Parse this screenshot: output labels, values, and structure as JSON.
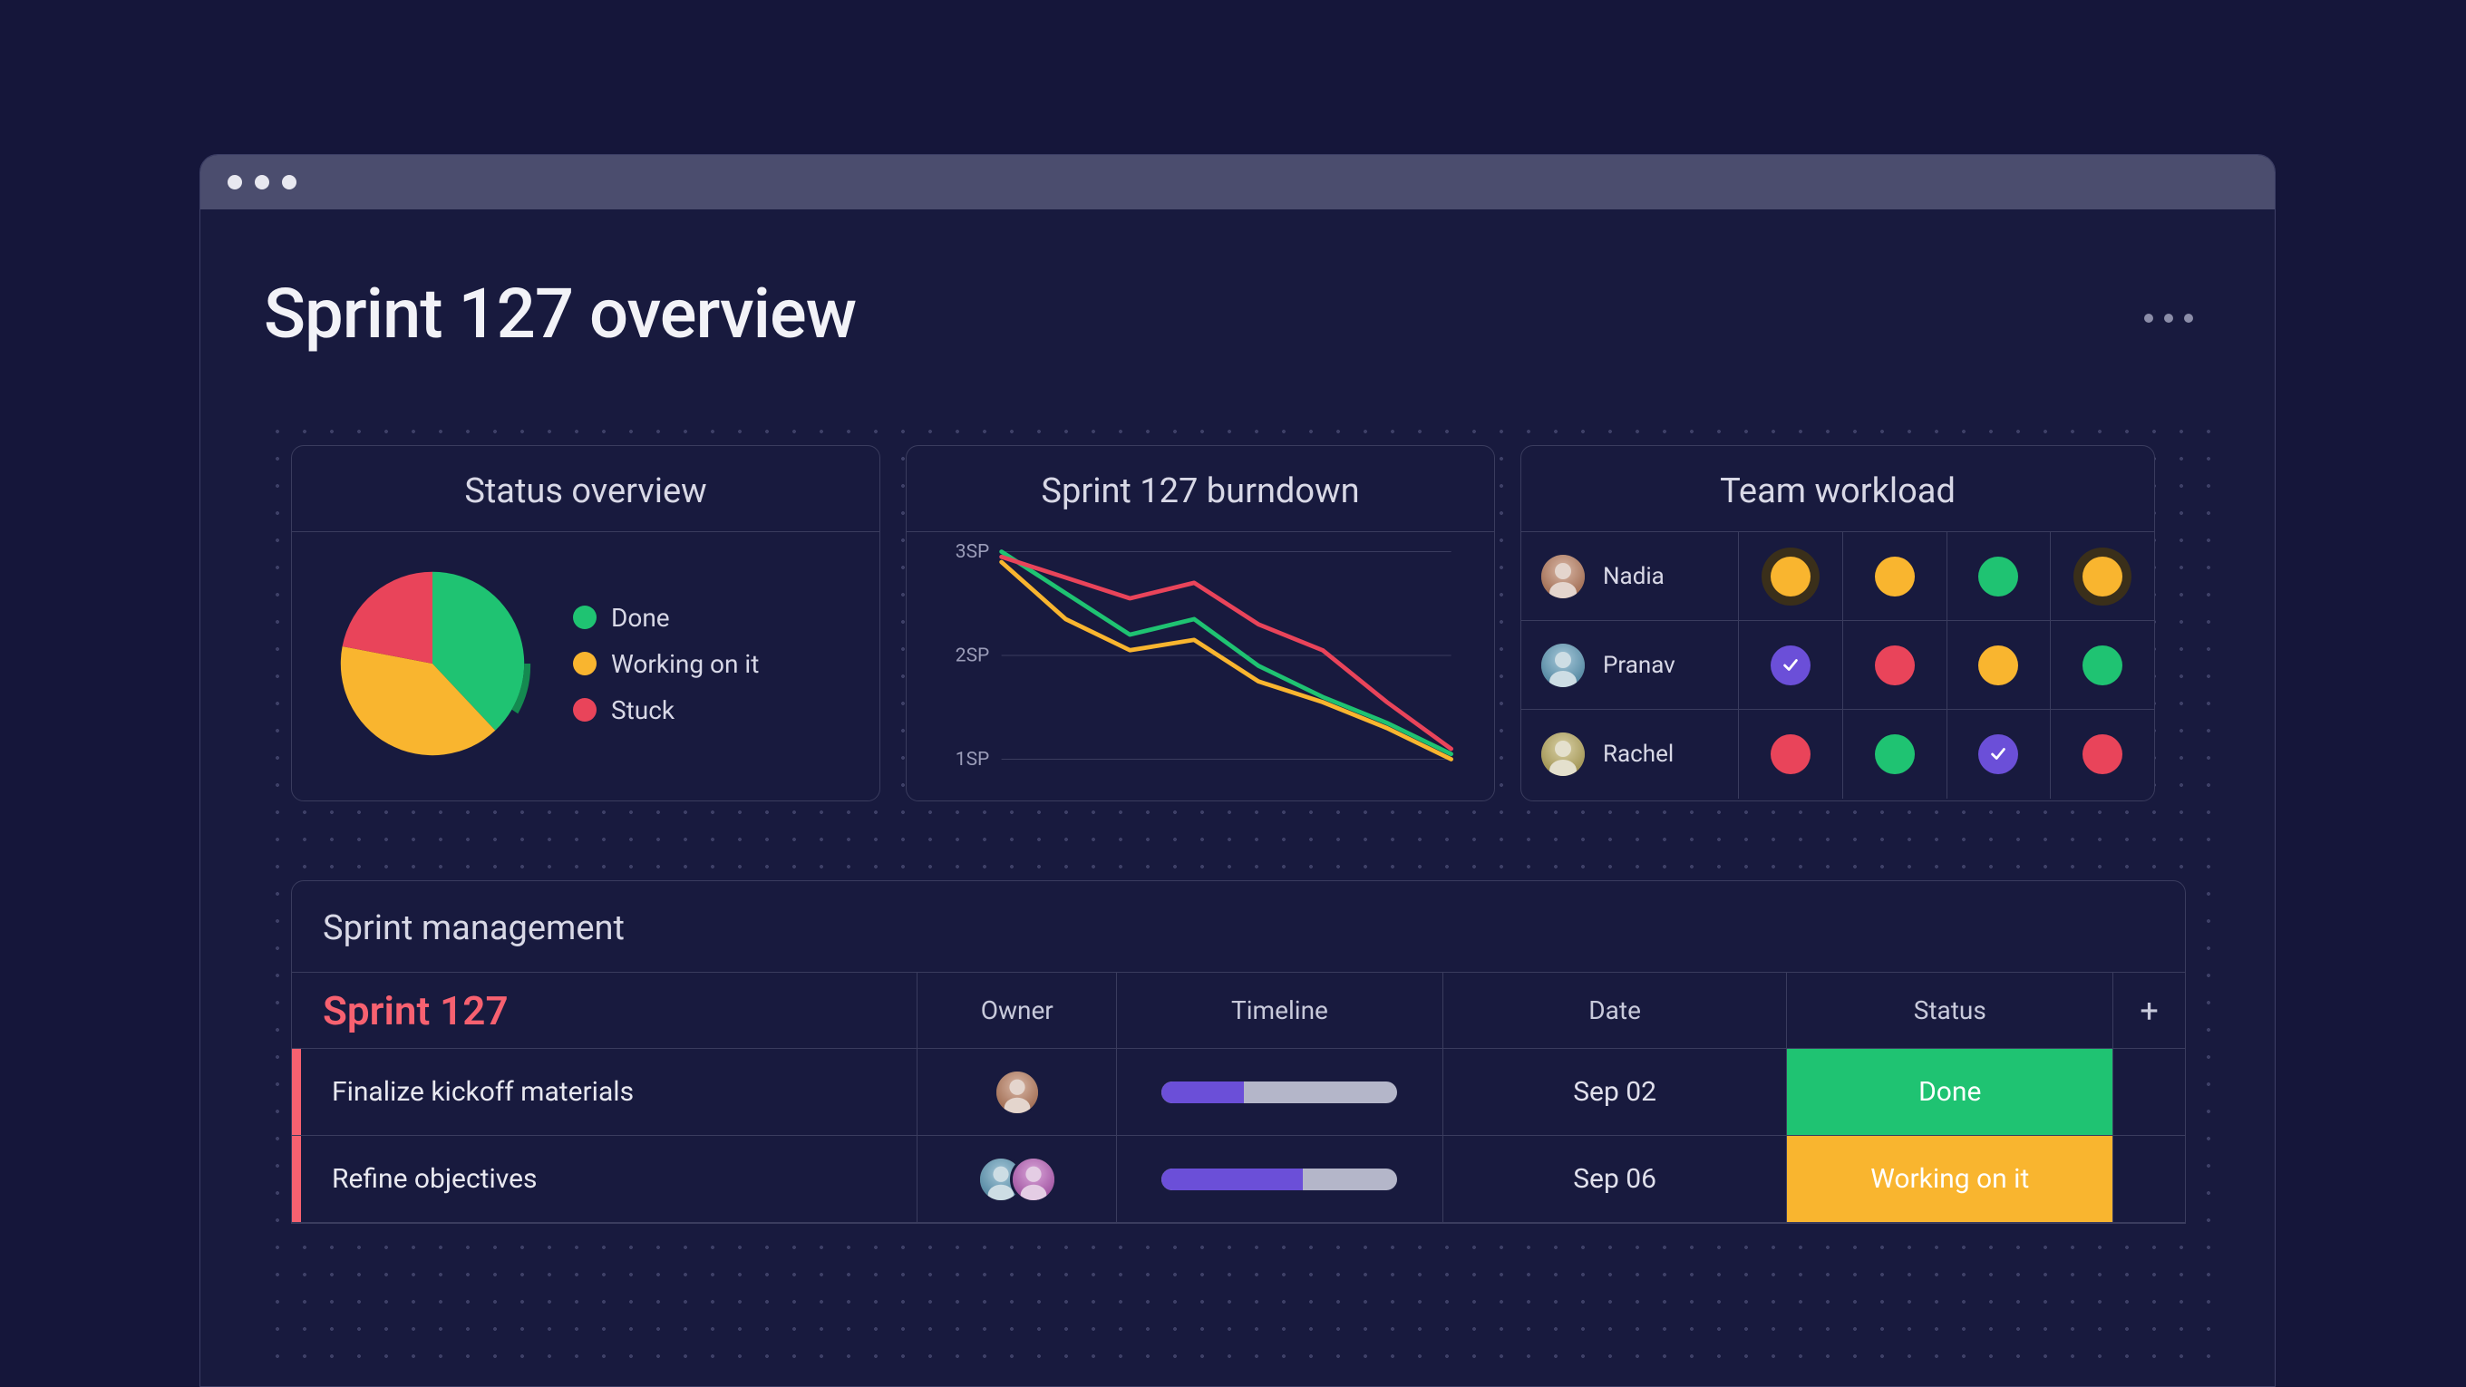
{
  "page_title": "Sprint 127 overview",
  "colors": {
    "green": "#1fc372",
    "orange": "#f9b52f",
    "red": "#e9445a",
    "purple": "#6b4fd8"
  },
  "status_overview": {
    "title": "Status overview",
    "legend": [
      {
        "label": "Done",
        "color": "#1fc372"
      },
      {
        "label": "Working on it",
        "color": "#f9b52f"
      },
      {
        "label": "Stuck",
        "color": "#e9445a"
      }
    ]
  },
  "burndown": {
    "title": "Sprint 127 burndown",
    "yticks": [
      "3SP",
      "2SP",
      "1SP"
    ]
  },
  "team_workload": {
    "title": "Team workload",
    "rows": [
      {
        "name": "Nadia",
        "cells": [
          {
            "color": "#f9b52f",
            "ring": true
          },
          {
            "color": "#f9b52f"
          },
          {
            "color": "#1fc372"
          },
          {
            "color": "#f9b52f",
            "ring": true
          }
        ]
      },
      {
        "name": "Pranav",
        "cells": [
          {
            "color": "#6b4fd8",
            "check": true
          },
          {
            "color": "#e9445a"
          },
          {
            "color": "#f9b52f"
          },
          {
            "color": "#1fc372"
          }
        ]
      },
      {
        "name": "Rachel",
        "cells": [
          {
            "color": "#e9445a"
          },
          {
            "color": "#1fc372"
          },
          {
            "color": "#6b4fd8",
            "check": true
          },
          {
            "color": "#e9445a"
          }
        ]
      }
    ]
  },
  "sprint_management": {
    "title": "Sprint management",
    "sprint_label": "Sprint 127",
    "columns": {
      "owner": "Owner",
      "timeline": "Timeline",
      "date": "Date",
      "status": "Status",
      "plus": "+"
    },
    "rows": [
      {
        "task": "Finalize kickoff materials",
        "owners": 1,
        "timeline_pct": 35,
        "date": "Sep 02",
        "status_label": "Done",
        "status_color": "#1fc372"
      },
      {
        "task": "Refine objectives",
        "owners": 2,
        "timeline_pct": 60,
        "date": "Sep 06",
        "status_label": "Working on it",
        "status_color": "#f9b52f"
      }
    ]
  },
  "chart_data": [
    {
      "type": "pie",
      "title": "Status overview",
      "categories": [
        "Done",
        "Working on it",
        "Stuck"
      ],
      "values": [
        38,
        40,
        22
      ],
      "colors": [
        "#1fc372",
        "#f9b52f",
        "#e9445a"
      ]
    },
    {
      "type": "line",
      "title": "Sprint 127 burndown",
      "ylabel": "SP",
      "ylim": [
        1,
        3
      ],
      "yticks": [
        1,
        2,
        3
      ],
      "x": [
        0,
        1,
        2,
        3,
        4,
        5,
        6,
        7
      ],
      "series": [
        {
          "name": "Done",
          "color": "#1fc372",
          "values": [
            3.0,
            2.6,
            2.2,
            2.35,
            1.9,
            1.6,
            1.35,
            1.05
          ]
        },
        {
          "name": "Working on it",
          "color": "#f9b52f",
          "values": [
            2.9,
            2.35,
            2.05,
            2.15,
            1.75,
            1.55,
            1.3,
            1.0
          ]
        },
        {
          "name": "Stuck",
          "color": "#e9445a",
          "values": [
            2.95,
            2.75,
            2.55,
            2.7,
            2.3,
            2.05,
            1.55,
            1.1
          ]
        }
      ]
    }
  ]
}
